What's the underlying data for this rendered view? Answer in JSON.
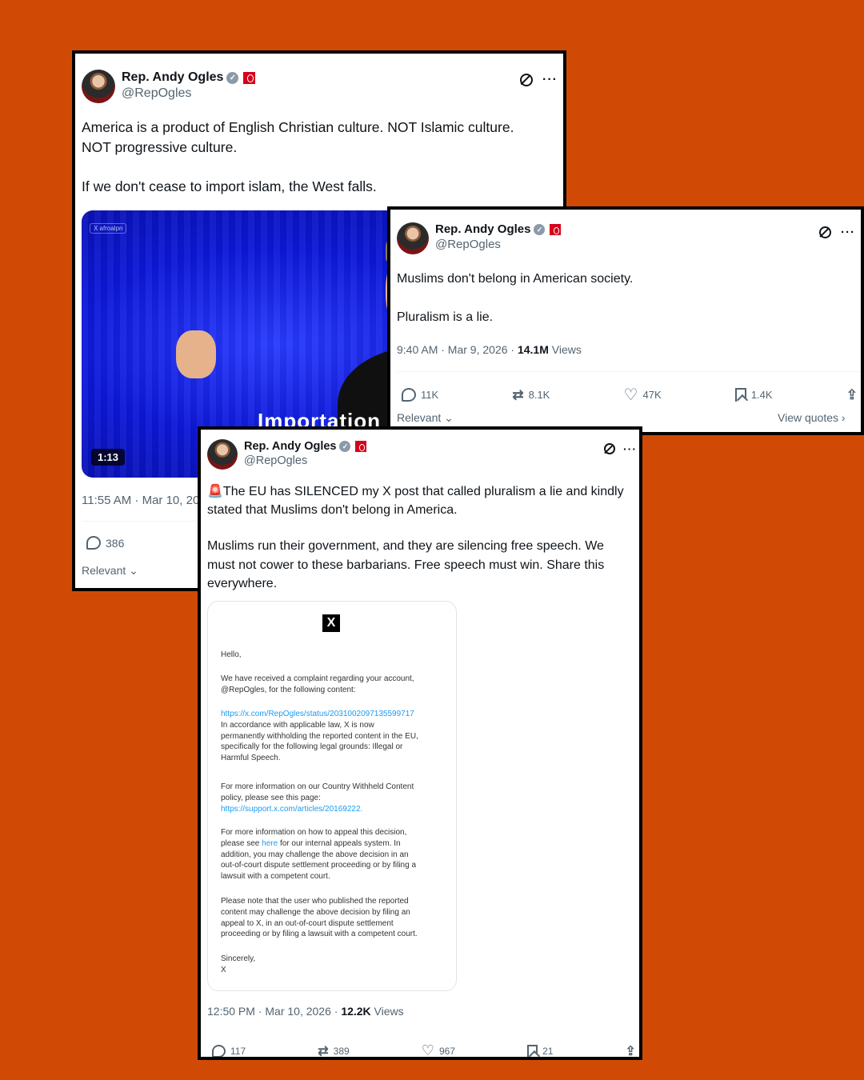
{
  "card1": {
    "author": {
      "name": "Rep. Andy Ogles",
      "handle": "@RepOgles"
    },
    "text_lines": [
      "America is a product of English Christian culture. NOT Islamic culture.",
      "NOT progressive culture.",
      "If we don't cease to import islam, the West falls."
    ],
    "video": {
      "watermark": "X afroalpn",
      "caption": "Importation",
      "duration": "1:13"
    },
    "timestamp": "11:55 AM · Mar 10, 20",
    "replies": "386",
    "relevant": "Relevant"
  },
  "card2": {
    "author": {
      "name": "Rep. Andy Ogles",
      "handle": "@RepOgles"
    },
    "text_lines": [
      "Muslims don't belong in American society.",
      "Pluralism is a lie."
    ],
    "timestamp": "9:40 AM · Mar 9, 2026 · ",
    "views_count": "14.1M",
    "views_label": " Views",
    "stats": {
      "replies": "11K",
      "reposts": "8.1K",
      "likes": "47K",
      "bookmarks": "1.4K"
    },
    "relevant": "Relevant",
    "view_quotes": "View quotes ›"
  },
  "card3": {
    "author": {
      "name": "Rep. Andy Ogles",
      "handle": "@RepOgles"
    },
    "text_lines": [
      "🚨The EU has SILENCED my X post that called pluralism a lie and kindly",
      "stated that Muslims don't belong in America.",
      "Muslims run their government, and they are silencing free speech. We",
      "must not cower to these barbarians. Free speech must win. Share this",
      "everywhere."
    ],
    "email": {
      "logo": "X",
      "greeting": "Hello,",
      "p1": [
        "We have received a complaint regarding your account,",
        "@RepOgles, for the following content:"
      ],
      "link1": "https://x.com/RepOgles/status/2031002097135599717",
      "p2": [
        "In accordance with applicable law, X is now",
        "permanently withholding the reported content in the EU,",
        "specifically for the following legal grounds: Illegal or",
        "Harmful Speech."
      ],
      "p3": [
        "For more information on our Country Withheld Content",
        "policy, please see this page:"
      ],
      "link2": "https://support.x.com/articles/20169222.",
      "p4a": "For more information on how to appeal this decision,",
      "p4b_pre": "please see ",
      "p4b_link": "here",
      "p4b_post": " for our internal appeals system. In",
      "p4c": [
        "addition, you may challenge the above decision in an",
        "out-of-court dispute settlement proceeding or by filing a",
        "lawsuit with a competent court."
      ],
      "p5": [
        "Please note that the user who published the reported",
        "content may challenge the above decision by filing an",
        "appeal to X, in an out-of-court dispute settlement",
        "proceeding or by filing a lawsuit with a competent court."
      ],
      "signoff": "Sincerely,",
      "sig": "X"
    },
    "timestamp": "12:50 PM · Mar 10, 2026 · ",
    "views_count": "12.2K",
    "views_label": " Views",
    "stats": {
      "replies": "117",
      "reposts": "389",
      "likes": "967",
      "bookmarks": "21"
    }
  },
  "colors": {
    "background": "#d04a06",
    "link": "#1d9bf0",
    "muted": "#536471",
    "video_blue": "#0d18d8"
  },
  "icons": [
    "verified-badge-icon",
    "flag-badge-icon",
    "grok-icon",
    "more-icon",
    "reply-icon",
    "repost-icon",
    "like-icon",
    "bookmark-icon",
    "share-icon",
    "chevron-down-icon",
    "x-logo-icon"
  ]
}
